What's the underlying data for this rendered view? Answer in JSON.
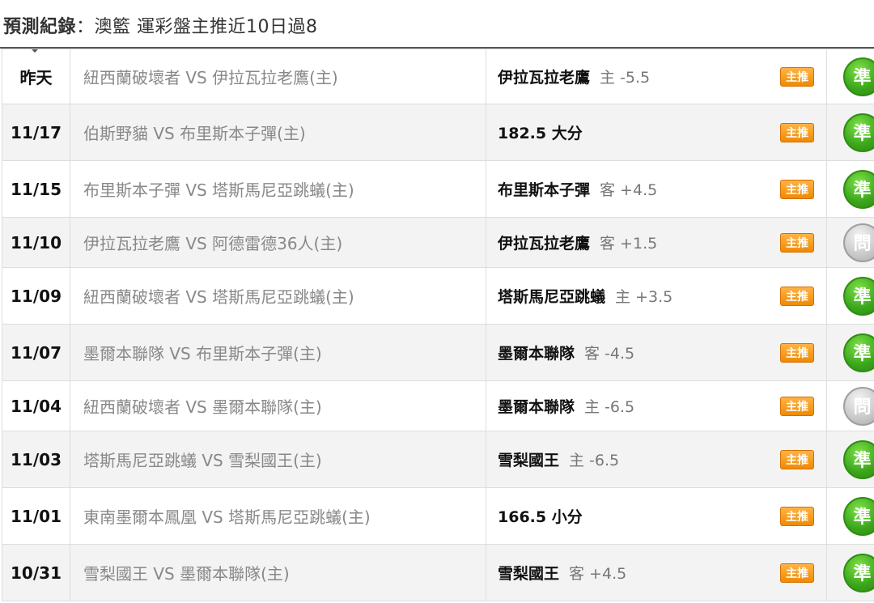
{
  "header": {
    "title_bold": "預測紀錄",
    "title_rest": "：澳籃 運彩盤主推近10日過8"
  },
  "badge_label": "主推",
  "rows": [
    {
      "date": "昨天",
      "match": "紐西蘭破壞者 VS 伊拉瓦拉老鷹(主)",
      "pick": "伊拉瓦拉老鷹",
      "line": "主 -5.5",
      "result": "準",
      "result_type": "win"
    },
    {
      "date": "11/17",
      "match": "伯斯野貓 VS 布里斯本子彈(主)",
      "pick": "182.5 大分",
      "line": "",
      "result": "準",
      "result_type": "win"
    },
    {
      "date": "11/15",
      "match": "布里斯本子彈 VS 塔斯馬尼亞跳蟻(主)",
      "pick": "布里斯本子彈",
      "line": "客 +4.5",
      "result": "準",
      "result_type": "win"
    },
    {
      "date": "11/10",
      "match": "伊拉瓦拉老鷹 VS 阿德雷德36人(主)",
      "pick": "伊拉瓦拉老鷹",
      "line": "客 +1.5",
      "result": "問",
      "result_type": "push"
    },
    {
      "date": "11/09",
      "match": "紐西蘭破壞者 VS 塔斯馬尼亞跳蟻(主)",
      "pick": "塔斯馬尼亞跳蟻",
      "line": "主 +3.5",
      "result": "準",
      "result_type": "win"
    },
    {
      "date": "11/07",
      "match": "墨爾本聯隊 VS 布里斯本子彈(主)",
      "pick": "墨爾本聯隊",
      "line": "客 -4.5",
      "result": "準",
      "result_type": "win"
    },
    {
      "date": "11/04",
      "match": "紐西蘭破壞者 VS 墨爾本聯隊(主)",
      "pick": "墨爾本聯隊",
      "line": "主 -6.5",
      "result": "問",
      "result_type": "push"
    },
    {
      "date": "11/03",
      "match": "塔斯馬尼亞跳蟻 VS 雪梨國王(主)",
      "pick": "雪梨國王",
      "line": "主 -6.5",
      "result": "準",
      "result_type": "win"
    },
    {
      "date": "11/01",
      "match": "東南墨爾本鳳凰 VS 塔斯馬尼亞跳蟻(主)",
      "pick": "166.5 小分",
      "line": "",
      "result": "準",
      "result_type": "win"
    },
    {
      "date": "10/31",
      "match": "雪梨國王 VS 墨爾本聯隊(主)",
      "pick": "雪梨國王",
      "line": "客 +4.5",
      "result": "準",
      "result_type": "win"
    }
  ]
}
